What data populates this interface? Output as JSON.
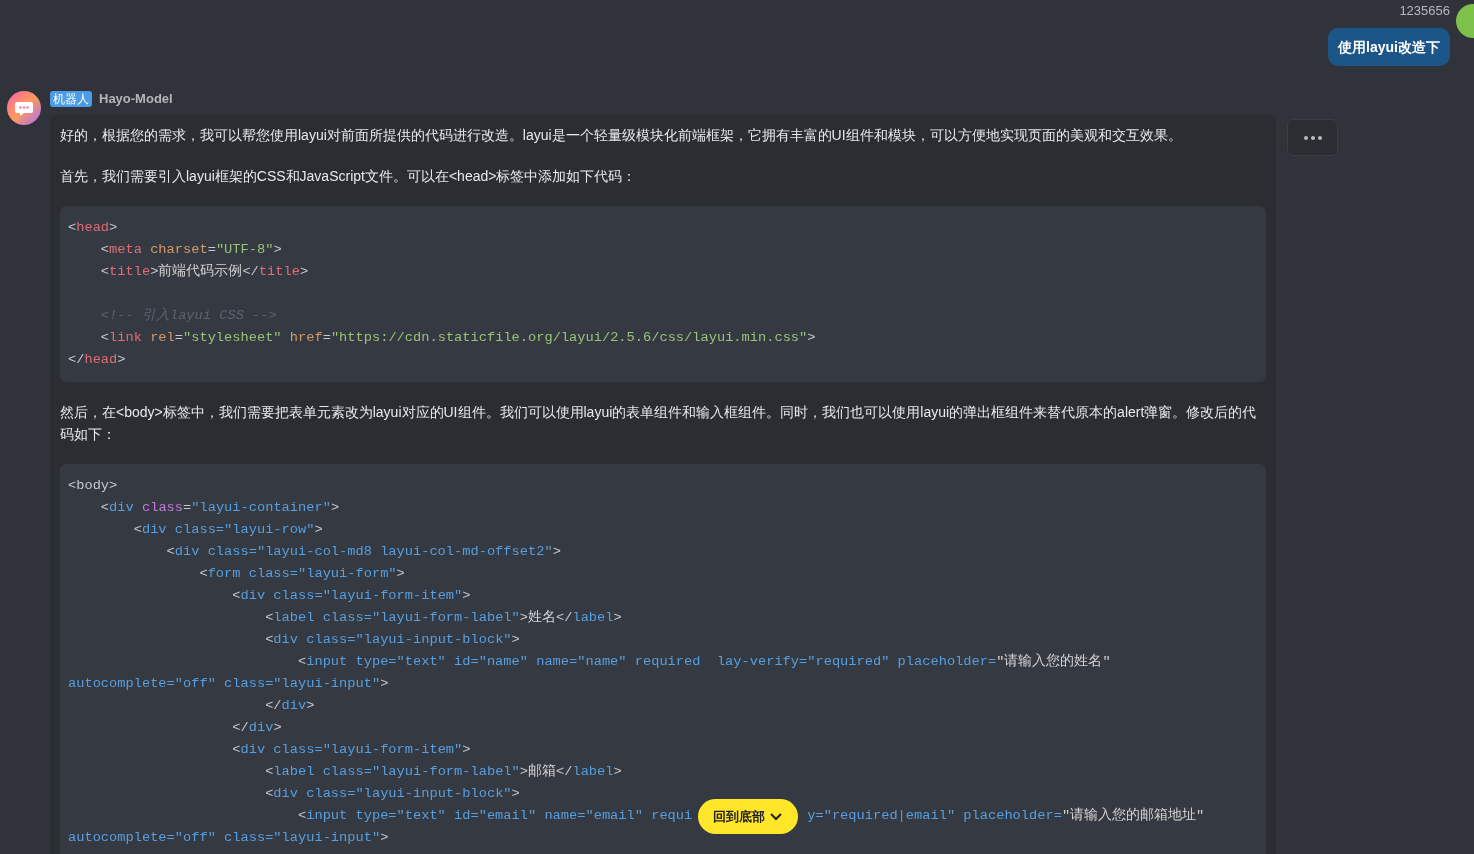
{
  "user_message": {
    "username": "1235656",
    "text": "使用layui改造下"
  },
  "bot_message": {
    "badge": "机器人",
    "name": "Hayo-Model",
    "blocks": [
      {
        "kind": "paragraph",
        "text": "好的，根据您的需求，我可以帮您使用layui对前面所提供的代码进行改造。layui是一个轻量级模块化前端框架，它拥有丰富的UI组件和模块，可以方便地实现页面的美观和交互效果。"
      },
      {
        "kind": "paragraph",
        "text": "首先，我们需要引入layui框架的CSS和JavaScript文件。可以在<head>标签中添加如下代码："
      },
      {
        "kind": "code",
        "lines": [
          {
            "kind": "code",
            "segments": [
              [
                {
                  "kind": "punct",
                  "text": "<"
                },
                {
                  "kind": "tag",
                  "text": "head"
                },
                {
                  "kind": "punct",
                  "text": ">"
                }
              ]
            ]
          },
          {
            "kind": "code",
            "segments": [
              [
                {
                  "kind": "punct",
                  "text": "    <"
                },
                {
                  "kind": "tag",
                  "text": "meta"
                },
                {
                  "kind": "attr",
                  "text": " charset"
                },
                {
                  "kind": "punct",
                  "text": "="
                },
                {
                  "kind": "string",
                  "text": "\"UTF-8\""
                },
                {
                  "kind": "punct",
                  "text": ">"
                }
              ]
            ]
          },
          {
            "kind": "code",
            "segments": [
              [
                {
                  "kind": "punct",
                  "text": "    <"
                },
                {
                  "kind": "tag",
                  "text": "title"
                },
                {
                  "kind": "punct",
                  "text": ">"
                },
                {
                  "kind": "text",
                  "text": "前端代码示例"
                },
                {
                  "kind": "punct",
                  "text": "</"
                },
                {
                  "kind": "tag",
                  "text": "title"
                },
                {
                  "kind": "punct",
                  "text": ">"
                }
              ]
            ]
          },
          {
            "kind": "blank"
          },
          {
            "kind": "code",
            "segments": [
              [
                {
                  "kind": "comment",
                  "text": "    <!-- 引入layui CSS -->"
                }
              ]
            ]
          },
          {
            "kind": "code",
            "segments": [
              [
                {
                  "kind": "punct",
                  "text": "    <"
                },
                {
                  "kind": "tag",
                  "text": "link"
                },
                {
                  "kind": "attr",
                  "text": " rel"
                },
                {
                  "kind": "punct",
                  "text": "="
                },
                {
                  "kind": "string",
                  "text": "\"stylesheet\""
                },
                {
                  "kind": "attr",
                  "text": " href"
                },
                {
                  "kind": "punct",
                  "text": "="
                },
                {
                  "kind": "string",
                  "text": "\"https://cdn.staticfile.org/layui/2.5.6/css/layui.min.css\""
                },
                {
                  "kind": "punct",
                  "text": ">"
                }
              ]
            ]
          },
          {
            "kind": "code",
            "segments": [
              [
                {
                  "kind": "punct",
                  "text": "</"
                },
                {
                  "kind": "tag",
                  "text": "head"
                },
                {
                  "kind": "punct",
                  "text": ">"
                }
              ]
            ]
          }
        ]
      },
      {
        "kind": "paragraph",
        "text": "然后，在<body>标签中，我们需要把表单元素改为layui对应的UI组件。我们可以使用layui的表单组件和输入框组件。同时，我们也可以使用layui的弹出框组件来替代原本的alert弹窗。修改后的代码如下："
      },
      {
        "kind": "code",
        "lines": [
          {
            "kind": "code",
            "segments": [
              [
                {
                  "kind": "punct",
                  "text": "<body>"
                }
              ]
            ]
          },
          {
            "kind": "code",
            "segments": [
              [
                {
                  "kind": "punct",
                  "text": "    <"
                },
                {
                  "kind": "name",
                  "text": "div"
                },
                {
                  "kind": "keyword",
                  "text": " class"
                },
                {
                  "kind": "punct",
                  "text": "="
                },
                {
                  "kind": "name",
                  "text": "\"layui-container\""
                },
                {
                  "kind": "punct",
                  "text": ">"
                }
              ]
            ]
          },
          {
            "kind": "code",
            "segments": [
              [
                {
                  "kind": "punct",
                  "text": "        <"
                },
                {
                  "kind": "name",
                  "text": "div class=\"layui-row\""
                },
                {
                  "kind": "punct",
                  "text": ">"
                }
              ]
            ]
          },
          {
            "kind": "code",
            "segments": [
              [
                {
                  "kind": "punct",
                  "text": "            <"
                },
                {
                  "kind": "name",
                  "text": "div class=\"layui-col-md8 layui-col-md-offset2\""
                },
                {
                  "kind": "punct",
                  "text": ">"
                }
              ]
            ]
          },
          {
            "kind": "code",
            "segments": [
              [
                {
                  "kind": "punct",
                  "text": "                <"
                },
                {
                  "kind": "name",
                  "text": "form class=\"layui-form\""
                },
                {
                  "kind": "punct",
                  "text": ">"
                }
              ]
            ]
          },
          {
            "kind": "code",
            "segments": [
              [
                {
                  "kind": "punct",
                  "text": "                    <"
                },
                {
                  "kind": "name",
                  "text": "div class=\"layui-form-item\""
                },
                {
                  "kind": "punct",
                  "text": ">"
                }
              ]
            ]
          },
          {
            "kind": "code",
            "segments": [
              [
                {
                  "kind": "punct",
                  "text": "                        <"
                },
                {
                  "kind": "name",
                  "text": "label class=\"layui-form-label\""
                },
                {
                  "kind": "punct",
                  "text": ">"
                },
                {
                  "kind": "text",
                  "text": "姓名"
                },
                {
                  "kind": "punct",
                  "text": "</"
                },
                {
                  "kind": "name",
                  "text": "label"
                },
                {
                  "kind": "punct",
                  "text": ">"
                }
              ]
            ]
          },
          {
            "kind": "code",
            "segments": [
              [
                {
                  "kind": "punct",
                  "text": "                        <"
                },
                {
                  "kind": "name",
                  "text": "div class=\"layui-input-block\""
                },
                {
                  "kind": "punct",
                  "text": ">"
                }
              ]
            ]
          },
          {
            "kind": "code",
            "segments": [
              [
                {
                  "kind": "punct",
                  "text": "                            <"
                },
                {
                  "kind": "name",
                  "text": "input type=\"text\" id=\"name\" name=\"name\" required  lay-verify=\"required\" placeholder="
                },
                {
                  "kind": "text",
                  "text": "\"请输入您的姓名\""
                }
              ]
            ]
          },
          {
            "kind": "code",
            "segments": [
              [
                {
                  "kind": "name",
                  "text": "autocomplete=\"off\" class=\"layui-input\""
                },
                {
                  "kind": "punct",
                  "text": ">"
                }
              ]
            ]
          },
          {
            "kind": "code",
            "segments": [
              [
                {
                  "kind": "punct",
                  "text": "                        </"
                },
                {
                  "kind": "name",
                  "text": "div"
                },
                {
                  "kind": "punct",
                  "text": ">"
                }
              ]
            ]
          },
          {
            "kind": "code",
            "segments": [
              [
                {
                  "kind": "punct",
                  "text": "                    </"
                },
                {
                  "kind": "name",
                  "text": "div"
                },
                {
                  "kind": "punct",
                  "text": ">"
                }
              ]
            ]
          },
          {
            "kind": "code",
            "segments": [
              [
                {
                  "kind": "punct",
                  "text": "                    <"
                },
                {
                  "kind": "name",
                  "text": "div class=\"layui-form-item\""
                },
                {
                  "kind": "punct",
                  "text": ">"
                }
              ]
            ]
          },
          {
            "kind": "code",
            "segments": [
              [
                {
                  "kind": "punct",
                  "text": "                        <"
                },
                {
                  "kind": "name",
                  "text": "label class=\"layui-form-label\""
                },
                {
                  "kind": "punct",
                  "text": ">"
                },
                {
                  "kind": "text",
                  "text": "邮箱"
                },
                {
                  "kind": "punct",
                  "text": "</"
                },
                {
                  "kind": "name",
                  "text": "label"
                },
                {
                  "kind": "punct",
                  "text": ">"
                }
              ]
            ]
          },
          {
            "kind": "code",
            "segments": [
              [
                {
                  "kind": "punct",
                  "text": "                        <"
                },
                {
                  "kind": "name",
                  "text": "div class=\"layui-input-block\""
                },
                {
                  "kind": "punct",
                  "text": ">"
                }
              ]
            ]
          },
          {
            "kind": "code",
            "segments": [
              [
                {
                  "kind": "punct",
                  "text": "                            <"
                },
                {
                  "kind": "name",
                  "text": "input type=\"text\" id=\"email\" name=\"email\" requi"
                }
              ],
              [
                {
                  "kind": "name",
                  "text": "y=\"required|email\" placeholder="
                },
                {
                  "kind": "text",
                  "text": "\"请输入您的邮箱地址\""
                }
              ]
            ]
          },
          {
            "kind": "code",
            "segments": [
              [
                {
                  "kind": "name",
                  "text": "autocomplete=\"off\" class=\"layui-input\""
                },
                {
                  "kind": "punct",
                  "text": ">"
                }
              ]
            ]
          }
        ]
      }
    ]
  },
  "scroll_button": {
    "label": "回到底部"
  }
}
